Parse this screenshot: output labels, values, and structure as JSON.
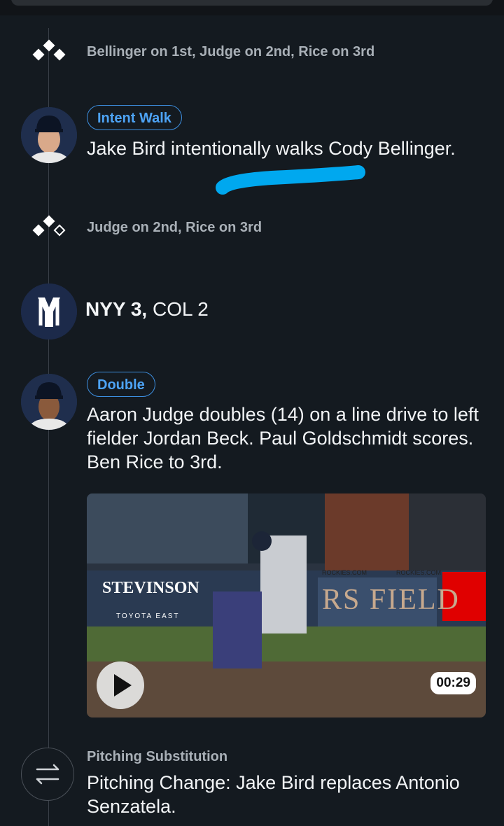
{
  "events": {
    "runners_1": "Bellinger on 1st, Judge on 2nd, Rice on 3rd",
    "intent_walk_badge": "Intent Walk",
    "intent_walk_desc": "Jake Bird intentionally walks Cody Bellinger.",
    "runners_2": "Judge on 2nd, Rice on 3rd",
    "double_badge": "Double",
    "double_desc": "Aaron Judge doubles (14) on a line drive to left fielder Jordan Beck. Paul Goldschmidt scores. Ben Rice to 3rd.",
    "sub_label": "Pitching Substitution",
    "sub_desc": "Pitching Change: Jake Bird replaces Antonio Senzatela."
  },
  "score": {
    "home": "NYY 3,",
    "away": "COL 2"
  },
  "video": {
    "duration": "00:29",
    "banner_stevinson": "STEVINSON",
    "banner_toyota": "TOYOTA EAST",
    "banner_field": "RS FIELD",
    "sign_rockies": "ROCKIES.COM"
  },
  "icons": {
    "bases_full": "bases-loaded-icon",
    "bases_two": "bases-2nd-3rd-icon",
    "team_logo": "yankees-logo",
    "substitution": "swap-arrows-icon",
    "play": "play-icon"
  },
  "colors": {
    "background": "#141a20",
    "badge_blue": "#4da3f5",
    "highlight": "#00a8ef"
  }
}
